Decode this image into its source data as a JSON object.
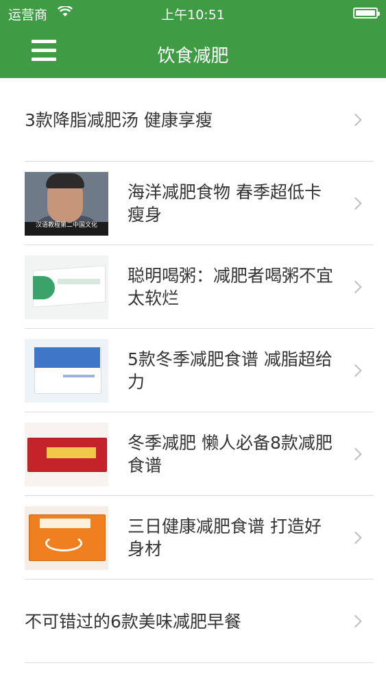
{
  "status_bar": {
    "carrier": "运营商",
    "time": "上午10:51"
  },
  "nav": {
    "title": "饮食减肥"
  },
  "items": [
    {
      "title": "3款降脂减肥汤 健康享瘦"
    },
    {
      "title": "海洋减肥食物 春季超低卡瘦身",
      "thumb_caption": "汉语教程第二中国文化"
    },
    {
      "title": "聪明喝粥：减肥者喝粥不宜太软烂"
    },
    {
      "title": "5款冬季减肥食谱 减脂超给力"
    },
    {
      "title": "冬季减肥 懒人必备8款减肥食谱"
    },
    {
      "title": "三日健康减肥食谱 打造好身材"
    },
    {
      "title": "不可错过的6款美味减肥早餐"
    }
  ]
}
